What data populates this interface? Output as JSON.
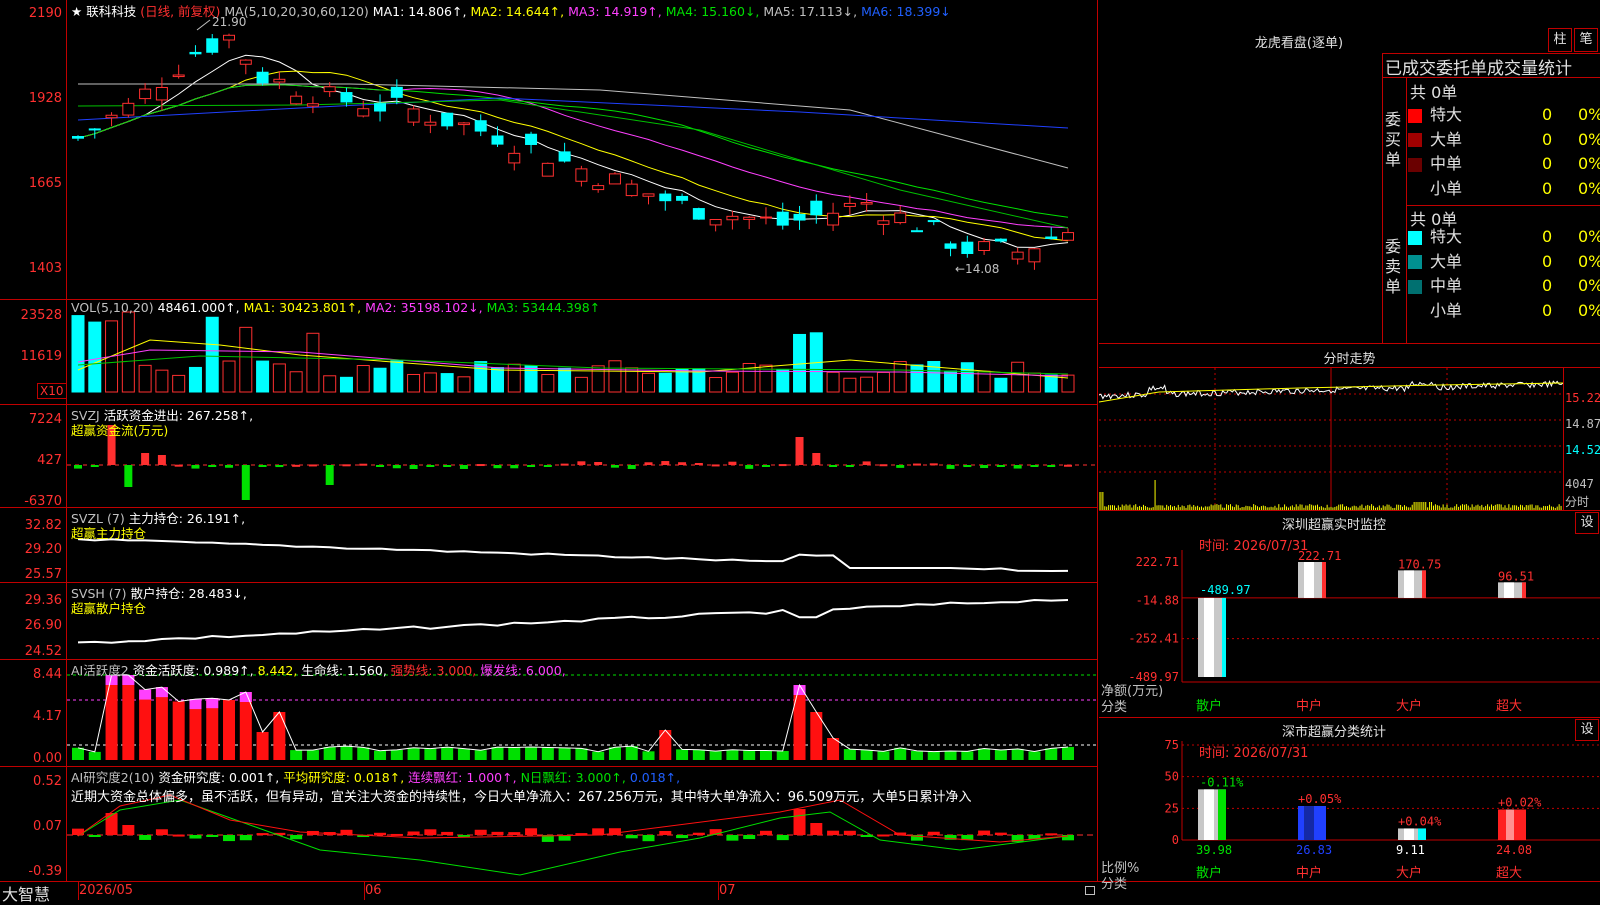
{
  "app_name": "大智慧",
  "main": {
    "star": "★",
    "stock": "联科科技",
    "period": "(日线, 前复权)",
    "ma_label": "MA(5,10,20,30,60,120)",
    "ma1": "MA1: 14.806↑,",
    "ma2": "MA2: 14.644↑,",
    "ma3": "MA3: 14.919↑,",
    "ma4": "MA4: 15.160↓,",
    "ma5": "MA5: 17.113↓,",
    "ma6": "MA6: 18.399↓",
    "high_mark": "21.90",
    "low_mark": "←14.08",
    "y_ticks": [
      "2190",
      "1928",
      "1665",
      "1403"
    ]
  },
  "vol": {
    "label": "VOL(5,10,20)",
    "value": "48461.000↑,",
    "ma1": "MA1: 30423.801↑,",
    "ma2": "MA2: 35198.102↓,",
    "ma3": "MA3: 53444.398↑",
    "y_ticks": [
      "23528",
      "11619"
    ],
    "unit": "X10"
  },
  "svzj": {
    "label": "SVZJ",
    "title": "活跃资金进出: 267.258↑,",
    "sub": "超赢资金流(万元)",
    "y_ticks": [
      "7224",
      "427",
      "-6370"
    ]
  },
  "svzl": {
    "label": "SVZL (7)",
    "title": "主力持仓: 26.191↑,",
    "sub": "超赢主力持仓",
    "y_ticks": [
      "32.82",
      "29.20",
      "25.57"
    ]
  },
  "svsh": {
    "label": "SVSH (7)",
    "title": "散户持仓: 28.483↓,",
    "sub": "超赢散户持仓",
    "y_ticks": [
      "29.36",
      "26.90",
      "24.52"
    ]
  },
  "ai1": {
    "label": "AI活跃度2",
    "t1": "资金活跃度: 0.989↑,",
    "t2": "8.442,",
    "t3": "生命线: 1.560,",
    "t4": "强势线: 3.000,",
    "t5": "爆发线: 6.000,",
    "y_ticks": [
      "8.44",
      "4.17",
      "0.00"
    ]
  },
  "ai2": {
    "label": "AI研究度2(10)",
    "t1": "资金研究度: 0.001↑,",
    "t2": "平均研究度: 0.018↑,",
    "t3": "连续飘红: 1.000↑,",
    "t4": "N日飘红: 3.000↑,",
    "t5": "0.018↑,",
    "comment": "近期大资金总体偏多，虽不活跃，但有异动，宜关注大资金的持续性，今日大单净流入：267.256万元，其中特大单净流入：96.509万元，大单5日累计净入",
    "y_ticks": [
      "0.52",
      "0.07",
      "-0.39"
    ]
  },
  "date_axis": [
    "2026/05",
    "06",
    "07"
  ],
  "right": {
    "dragon": {
      "title": "龙虎看盘(逐单)",
      "btn1": "柱",
      "btn2": "笔",
      "header": "已成交委托单成交量统计",
      "buy_side": "委买单",
      "sell_side": "委卖单",
      "buy_total": "共 0单",
      "sell_total": "共 0单",
      "buy_rows": [
        {
          "label": "特大",
          "v": "0",
          "p": "0%",
          "color": "#ff0000"
        },
        {
          "label": "大单",
          "v": "0",
          "p": "0%",
          "color": "#a00000"
        },
        {
          "label": "中单",
          "v": "0",
          "p": "0%",
          "color": "#6a0000"
        },
        {
          "label": "小单",
          "v": "0",
          "p": "0%",
          "color": "#000000"
        }
      ],
      "sell_rows": [
        {
          "label": "特大",
          "v": "0",
          "p": "0%",
          "color": "#00ffff"
        },
        {
          "label": "大单",
          "v": "0",
          "p": "0%",
          "color": "#009090"
        },
        {
          "label": "中单",
          "v": "0",
          "p": "0%",
          "color": "#007070"
        },
        {
          "label": "小单",
          "v": "0",
          "p": "0%",
          "color": "#000000"
        }
      ]
    },
    "intraday": {
      "title": "分时走势",
      "y_ticks": [
        "15.22",
        "14.87",
        "14.52",
        "4047"
      ],
      "unit": "分时"
    },
    "monitor": {
      "title": "深圳超赢实时监控",
      "btn": "设",
      "time": "时间: 2026/07/31",
      "y_ticks": [
        "222.71",
        "-14.88",
        "-252.41",
        "-489.97"
      ],
      "ylabel1": "净额(万元)",
      "ylabel2": "分类",
      "categories": [
        "散户",
        "中户",
        "大户",
        "超大"
      ],
      "values": [
        -489.97,
        222.71,
        170.75,
        96.51
      ],
      "value_labels": [
        "-489.97",
        "222.71",
        "170.75",
        "96.51"
      ]
    },
    "stats": {
      "title": "深市超赢分类统计",
      "btn": "设",
      "time": "时间: 2026/07/31",
      "y_ticks": [
        "75",
        "50",
        "25",
        "0"
      ],
      "ylabel1": "比例%",
      "ylabel2": "分类",
      "categories": [
        "散户",
        "中户",
        "大户",
        "超大"
      ],
      "values": [
        39.98,
        26.83,
        9.11,
        24.08
      ],
      "value_labels": [
        "39.98",
        "26.83",
        "9.11",
        "24.08"
      ],
      "changes": [
        "-0.11%",
        "+0.05%",
        "+0.04%",
        "+0.02%"
      ],
      "colors": [
        "#00e000",
        "#2040ff",
        "#00ffff",
        "#ff3030"
      ]
    }
  },
  "chart_data": {
    "type": "bar",
    "title": "深圳超赢实时监控",
    "categories": [
      "散户",
      "中户",
      "大户",
      "超大"
    ],
    "series": [
      {
        "name": "净额(万元)",
        "values": [
          -489.97,
          222.71,
          170.75,
          96.51
        ]
      },
      {
        "name": "比例%",
        "values": [
          39.98,
          26.83,
          9.11,
          24.08
        ]
      }
    ]
  }
}
